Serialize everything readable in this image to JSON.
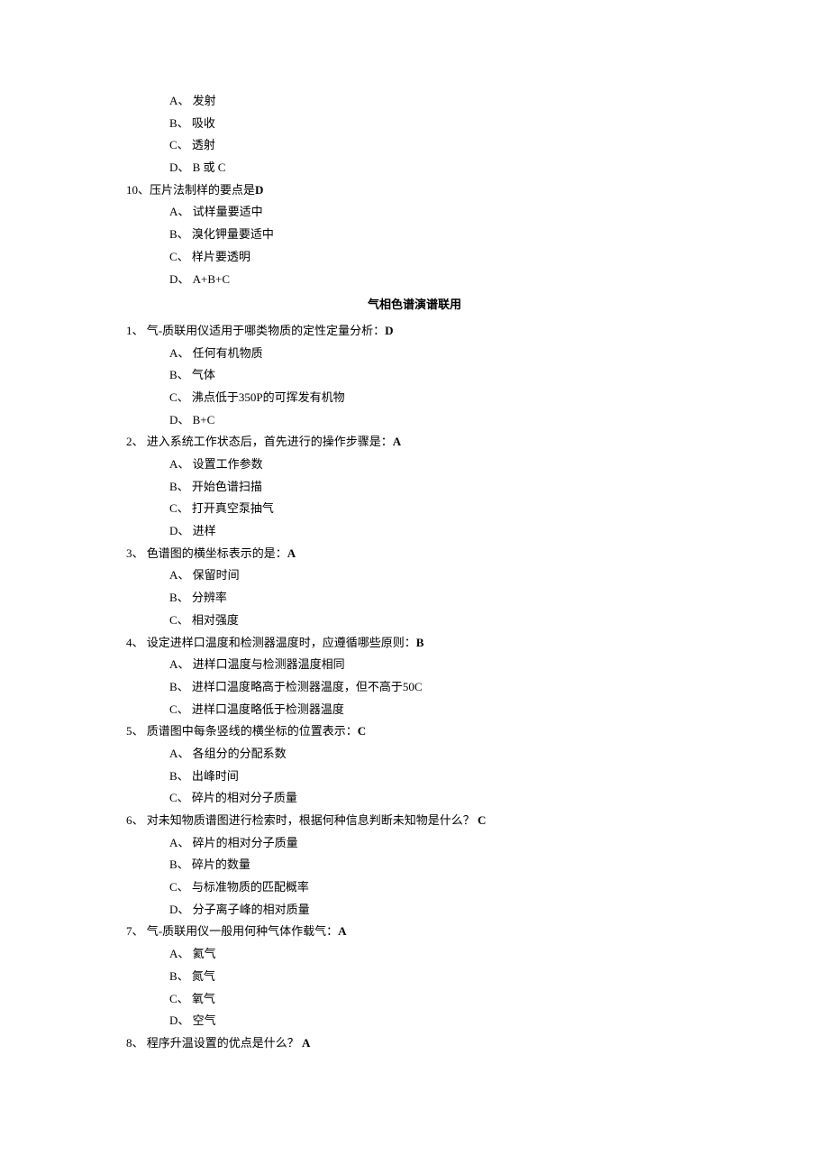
{
  "continuation": {
    "options": [
      "A、 发射",
      "B、 吸收",
      "C、 透射",
      "D、 B 或 C"
    ]
  },
  "q10": {
    "stem": "10、压片法制样的要点是",
    "answer": "D",
    "options": [
      "A、 试样量要适中",
      "B、 溴化钾量要适中",
      "C、 样片要透明",
      "D、 A+B+C"
    ]
  },
  "sectionTitle": "气相色谱演谱联用",
  "items": [
    {
      "stem": "1、 气-质联用仪适用于哪类物质的定性定量分析：",
      "answer": "D",
      "options": [
        "A、 任何有机物质",
        "B、 气体",
        "C、 沸点低于350P的可挥发有机物",
        "D、 B+C"
      ]
    },
    {
      "stem": "2、 进入系统工作状态后，首先进行的操作步骤是：",
      "answer": "A",
      "options": [
        "A、 设置工作参数",
        "B、 开始色谱扫描",
        "C、 打开真空泵抽气",
        "D、 进样"
      ]
    },
    {
      "stem": "3、 色谱图的横坐标表示的是：",
      "answer": "A",
      "options": [
        "A、 保留时间",
        "B、 分辨率",
        "C、 相对强度"
      ]
    },
    {
      "stem": "4、 设定进样口温度和检测器温度时，应遵循哪些原则：",
      "answer": "B",
      "options": [
        "A、 进样口温度与检测器温度相同",
        "B、 进样口温度略高于检测器温度，但不高于50C",
        "C、 进样口温度略低于检测器温度"
      ]
    },
    {
      "stem": "5、 质谱图中每条竖线的横坐标的位置表示：",
      "answer": "C",
      "options": [
        "A、 各组分的分配系数",
        "B、 出峰时间",
        "C、 碎片的相对分子质量"
      ]
    },
    {
      "stem": "6、 对未知物质谱图进行检索时，根据何种信息判断未知物是什么？ ",
      "answer": "C",
      "options": [
        "A、 碎片的相对分子质量",
        "B、 碎片的数量",
        "C、 与标准物质的匹配概率",
        "D、 分子离子峰的相对质量"
      ]
    },
    {
      "stem": "7、 气-质联用仪一般用何种气体作载气：",
      "answer": "A",
      "options": [
        "A、 氦气",
        "B、 氮气",
        "C、 氧气",
        "D、 空气"
      ]
    },
    {
      "stem": "8、 程序升温设置的优点是什么？ ",
      "answer": "A",
      "options": []
    }
  ]
}
